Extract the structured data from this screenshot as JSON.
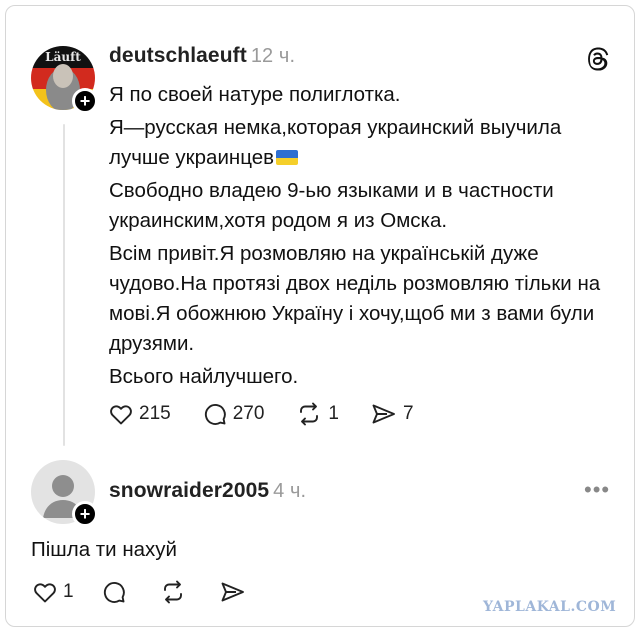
{
  "post": {
    "username": "deutschlaeuft",
    "time": "12 ч.",
    "avatar_text": "Läuft",
    "paragraphs": [
      "Я по своей натуре полиглотка.",
      "Я—русская немка,которая украинский выучила лучше украинцев",
      "Свободно владею 9-ью языками и в частности украинским,хотя родом я из Омска.",
      "Всім привіт.Я розмовляю на українській дуже чудово.На протязі двох неділь розмовляю тільки на мові.Я обожнюю Україну і хочу,щоб ми з вами були друзями.",
      "Всього найлучшего."
    ],
    "likes": "215",
    "comments": "270",
    "reposts": "1",
    "shares": "7"
  },
  "reply": {
    "username": "snowraider2005",
    "time": "4 ч.",
    "text": "Пішла ти нахуй",
    "likes": "1"
  },
  "watermark": "YAPLAKAL.COM",
  "colors": {
    "flag_blue": "#2e6fd1",
    "flag_yellow": "#f5cf2a",
    "muted": "#9a9a9a",
    "watermark": "#9fb6d8"
  }
}
